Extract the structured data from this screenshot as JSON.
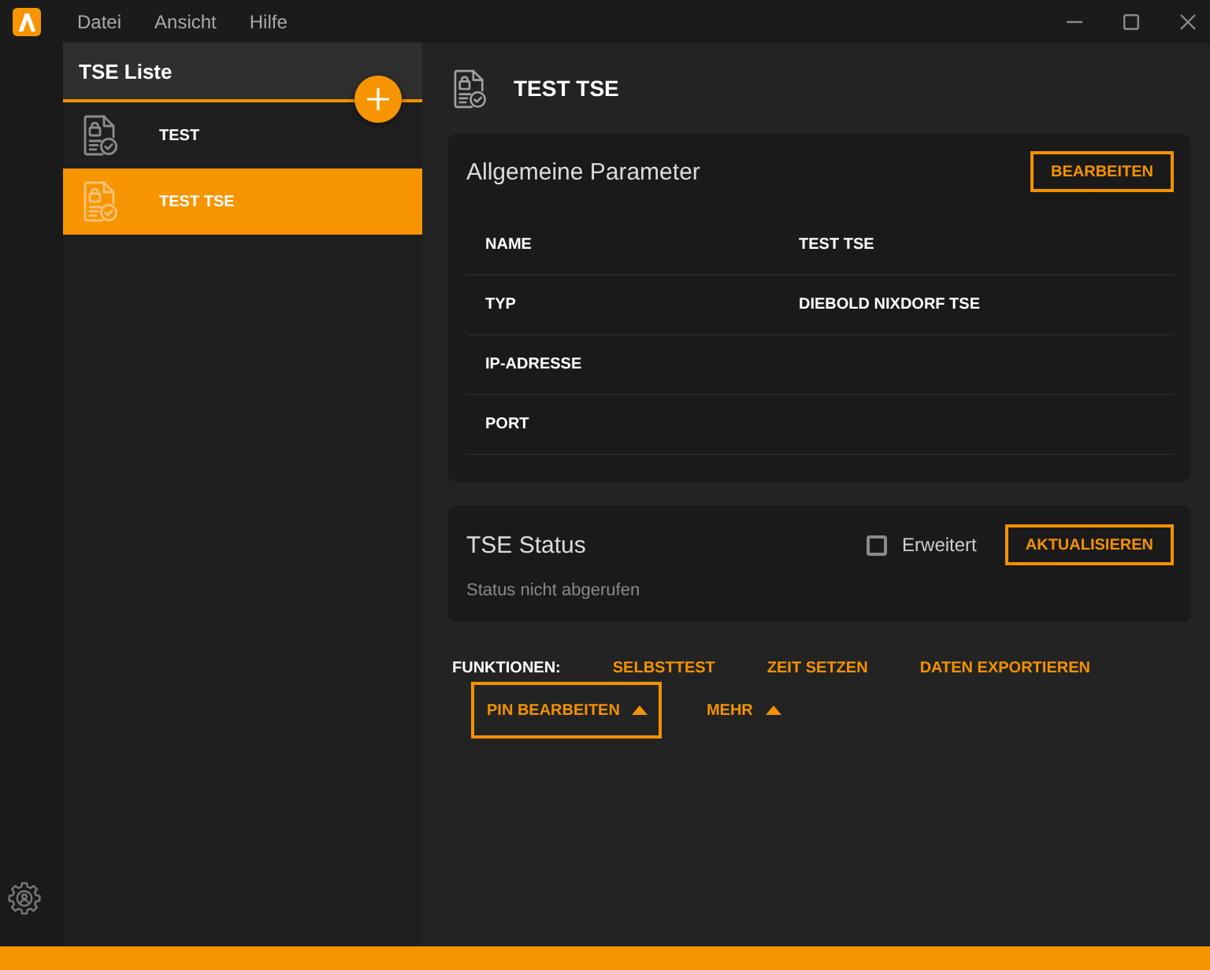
{
  "window": {
    "menu": [
      {
        "label": "Datei"
      },
      {
        "label": "Ansicht"
      },
      {
        "label": "Hilfe"
      }
    ]
  },
  "sidebar": {
    "title": "TSE Liste",
    "items": [
      {
        "label": "TEST",
        "selected": false
      },
      {
        "label": "TEST TSE",
        "selected": true
      }
    ]
  },
  "detail": {
    "title": "TEST TSE"
  },
  "parameters": {
    "title": "Allgemeine Parameter",
    "edit_button": "BEARBEITEN",
    "rows": [
      {
        "label": "NAME",
        "value": "TEST TSE"
      },
      {
        "label": "TYP",
        "value": "DIEBOLD NIXDORF TSE"
      },
      {
        "label": "IP-ADRESSE"
      },
      {
        "label": "PORT"
      }
    ]
  },
  "status": {
    "title": "TSE Status",
    "extended": {
      "label": "Erweitert",
      "checked": false
    },
    "refresh_button": "AKTUALISIEREN",
    "message": "Status nicht abgerufen"
  },
  "functions": {
    "label": "FUNKTIONEN:",
    "actions": [
      {
        "label": "SELBSTTEST",
        "kind": "link"
      },
      {
        "label": "ZEIT SETZEN",
        "kind": "link"
      },
      {
        "label": "DATEN EXPORTIEREN",
        "kind": "link"
      },
      {
        "label": "PIN BEARBEITEN",
        "kind": "menu",
        "focused": true
      },
      {
        "label": "MEHR",
        "kind": "menu",
        "focused": false
      }
    ]
  }
}
